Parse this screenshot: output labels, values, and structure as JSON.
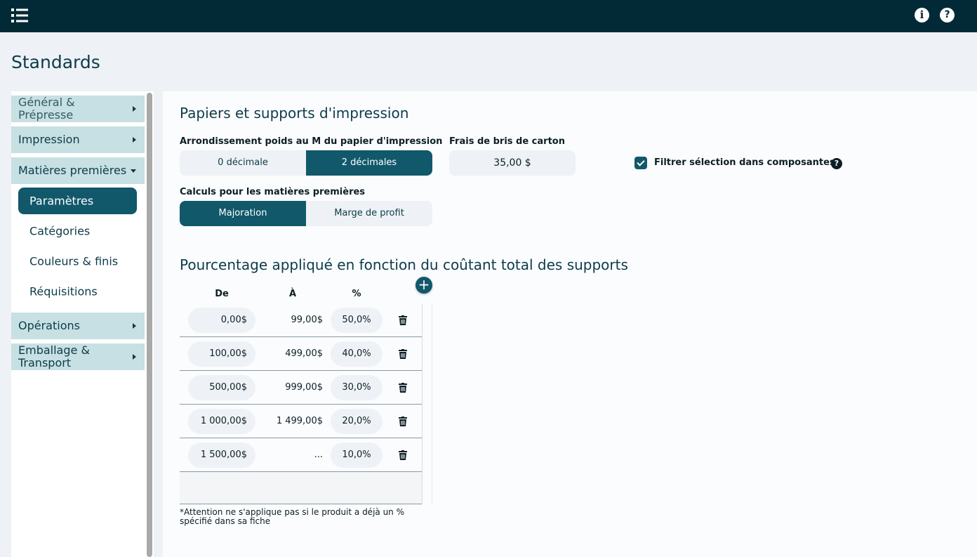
{
  "page": {
    "title": "Standards"
  },
  "topbar": {
    "info_icon": "info-icon",
    "help_icon": "help-icon",
    "menu_icon": "list-menu-icon"
  },
  "sidebar": {
    "sections": [
      {
        "label": "Général & Prépresse",
        "expanded": false
      },
      {
        "label": "Impression",
        "expanded": false
      },
      {
        "label": "Matières premières",
        "expanded": true,
        "items": [
          "Paramètres",
          "Catégories",
          "Couleurs & finis",
          "Réquisitions"
        ],
        "active_item": "Paramètres"
      },
      {
        "label": "Opérations",
        "expanded": false
      },
      {
        "label": "Emballage & Transport",
        "expanded": false
      }
    ]
  },
  "main": {
    "section1_title": "Papiers et supports d'impression",
    "rounding": {
      "label": "Arrondissement poids au M du papier d'impression",
      "options": [
        "0 décimale",
        "2 décimales"
      ],
      "selected": "2 décimales"
    },
    "carton": {
      "label": "Frais de bris de carton",
      "value": "35,00 $"
    },
    "filter": {
      "label": "Filtrer sélection dans composantes",
      "checked": true
    },
    "calc": {
      "label": "Calculs pour les matières premières",
      "options": [
        "Majoration",
        "Marge de profit"
      ],
      "selected": "Majoration"
    },
    "section2_title": "Pourcentage appliqué en fonction du coûtant total des supports",
    "table": {
      "headers": {
        "de": "De",
        "a": "À",
        "pct": "%"
      },
      "rows": [
        {
          "de": "0,00$",
          "a": "99,00$",
          "pct": "50,0%"
        },
        {
          "de": "100,00$",
          "a": "499,00$",
          "pct": "40,0%"
        },
        {
          "de": "500,00$",
          "a": "999,00$",
          "pct": "30,0%"
        },
        {
          "de": "1 000,00$",
          "a": "1 499,00$",
          "pct": "20,0%"
        },
        {
          "de": "1 500,00$",
          "a": "...",
          "pct": "10,0%"
        }
      ]
    },
    "note": "*Attention ne s'applique pas si le produit a déjà un % spécifié dans sa fiche"
  },
  "colors": {
    "topbar": "#022a36",
    "accent": "#11586b",
    "section_bg": "#c7e0e3"
  }
}
